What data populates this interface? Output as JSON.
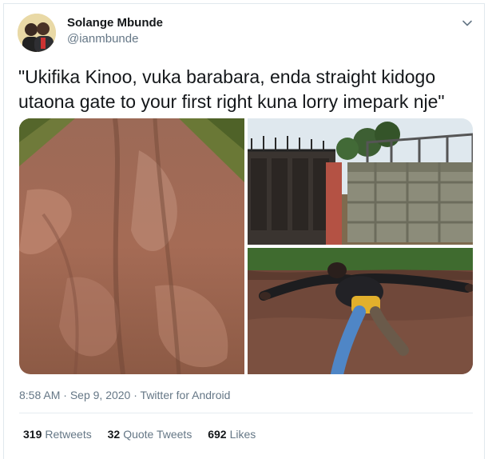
{
  "author": {
    "name": "Solange Mbunde",
    "handle": "@ianmbunde"
  },
  "icons": {
    "menu": "chevron-down-icon"
  },
  "tweet": {
    "text": "\"Ukifika Kinoo, vuka barabara, enda straight kidogo utaona gate to your first right kuna lorry imepark nje\""
  },
  "meta": {
    "time": "8:58 AM",
    "separator1": "·",
    "date": "Sep 9, 2020",
    "separator2": "·",
    "client": "Twitter for Android"
  },
  "stats": {
    "retweets": {
      "count": "319",
      "label": "Retweets"
    },
    "quotes": {
      "count": "32",
      "label": "Quote Tweets"
    },
    "likes": {
      "count": "692",
      "label": "Likes"
    }
  },
  "colors": {
    "secondary_text": "#657786",
    "border": "#e1e8ed"
  }
}
